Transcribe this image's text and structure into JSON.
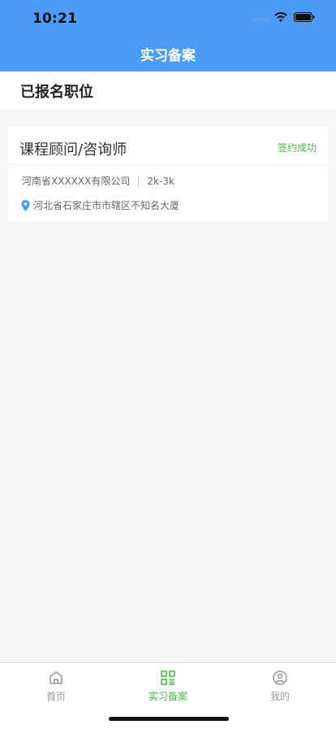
{
  "status_bar": {
    "time": "10:21"
  },
  "nav": {
    "title": "实习备案"
  },
  "section": {
    "title": "已报名职位"
  },
  "job": {
    "title": "课程顾问/咨询师",
    "status": "签约成功",
    "company": "河南省XXXXXX有限公司",
    "salary": "2k-3k",
    "address": "河北省石家庄市市辖区不知名大厦"
  },
  "tabs": [
    {
      "label": "首页",
      "icon": "home-icon",
      "active": false
    },
    {
      "label": "实习备案",
      "icon": "qrcode-icon",
      "active": true
    },
    {
      "label": "我的",
      "icon": "user-icon",
      "active": false
    }
  ],
  "colors": {
    "header_blue": "#4b9cf7",
    "success_green": "#43c143",
    "pin_blue": "#4b9cf7",
    "inactive_gray": "#9a9a9a"
  }
}
